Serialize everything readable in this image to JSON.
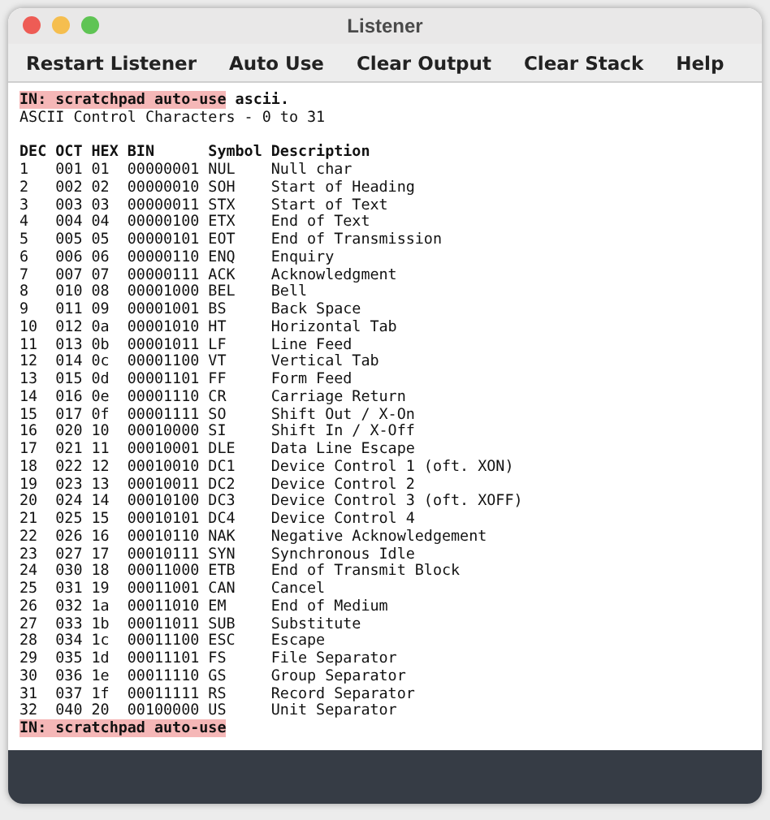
{
  "window": {
    "title": "Listener"
  },
  "toolbar": [
    "Restart Listener",
    "Auto Use",
    "Clear Output",
    "Clear Stack",
    "Help"
  ],
  "input_line": {
    "prompt": "IN: scratchpad auto-use",
    "input": "ascii."
  },
  "output_title": "ASCII Control Characters - 0 to 31",
  "table": {
    "columns": [
      "DEC",
      "OCT",
      "HEX",
      "BIN",
      "Symbol",
      "Description"
    ],
    "rows": [
      [
        "1",
        "001",
        "01",
        "00000001",
        "NUL",
        "Null char"
      ],
      [
        "2",
        "002",
        "02",
        "00000010",
        "SOH",
        "Start of Heading"
      ],
      [
        "3",
        "003",
        "03",
        "00000011",
        "STX",
        "Start of Text"
      ],
      [
        "4",
        "004",
        "04",
        "00000100",
        "ETX",
        "End of Text"
      ],
      [
        "5",
        "005",
        "05",
        "00000101",
        "EOT",
        "End of Transmission"
      ],
      [
        "6",
        "006",
        "06",
        "00000110",
        "ENQ",
        "Enquiry"
      ],
      [
        "7",
        "007",
        "07",
        "00000111",
        "ACK",
        "Acknowledgment"
      ],
      [
        "8",
        "010",
        "08",
        "00001000",
        "BEL",
        "Bell"
      ],
      [
        "9",
        "011",
        "09",
        "00001001",
        "BS",
        "Back Space"
      ],
      [
        "10",
        "012",
        "0a",
        "00001010",
        "HT",
        "Horizontal Tab"
      ],
      [
        "11",
        "013",
        "0b",
        "00001011",
        "LF",
        "Line Feed"
      ],
      [
        "12",
        "014",
        "0c",
        "00001100",
        "VT",
        "Vertical Tab"
      ],
      [
        "13",
        "015",
        "0d",
        "00001101",
        "FF",
        "Form Feed"
      ],
      [
        "14",
        "016",
        "0e",
        "00001110",
        "CR",
        "Carriage Return"
      ],
      [
        "15",
        "017",
        "0f",
        "00001111",
        "SO",
        "Shift Out / X-On"
      ],
      [
        "16",
        "020",
        "10",
        "00010000",
        "SI",
        "Shift In / X-Off"
      ],
      [
        "17",
        "021",
        "11",
        "00010001",
        "DLE",
        "Data Line Escape"
      ],
      [
        "18",
        "022",
        "12",
        "00010010",
        "DC1",
        "Device Control 1 (oft. XON)"
      ],
      [
        "19",
        "023",
        "13",
        "00010011",
        "DC2",
        "Device Control 2"
      ],
      [
        "20",
        "024",
        "14",
        "00010100",
        "DC3",
        "Device Control 3 (oft. XOFF)"
      ],
      [
        "21",
        "025",
        "15",
        "00010101",
        "DC4",
        "Device Control 4"
      ],
      [
        "22",
        "026",
        "16",
        "00010110",
        "NAK",
        "Negative Acknowledgement"
      ],
      [
        "23",
        "027",
        "17",
        "00010111",
        "SYN",
        "Synchronous Idle"
      ],
      [
        "24",
        "030",
        "18",
        "00011000",
        "ETB",
        "End of Transmit Block"
      ],
      [
        "25",
        "031",
        "19",
        "00011001",
        "CAN",
        "Cancel"
      ],
      [
        "26",
        "032",
        "1a",
        "00011010",
        "EM",
        "End of Medium"
      ],
      [
        "27",
        "033",
        "1b",
        "00011011",
        "SUB",
        "Substitute"
      ],
      [
        "28",
        "034",
        "1c",
        "00011100",
        "ESC",
        "Escape"
      ],
      [
        "29",
        "035",
        "1d",
        "00011101",
        "FS",
        "File Separator"
      ],
      [
        "30",
        "036",
        "1e",
        "00011110",
        "GS",
        "Group Separator"
      ],
      [
        "31",
        "037",
        "1f",
        "00011111",
        "RS",
        "Record Separator"
      ],
      [
        "32",
        "040",
        "20",
        "00100000",
        "US",
        "Unit Separator"
      ]
    ]
  },
  "prompt": "IN: scratchpad auto-use"
}
